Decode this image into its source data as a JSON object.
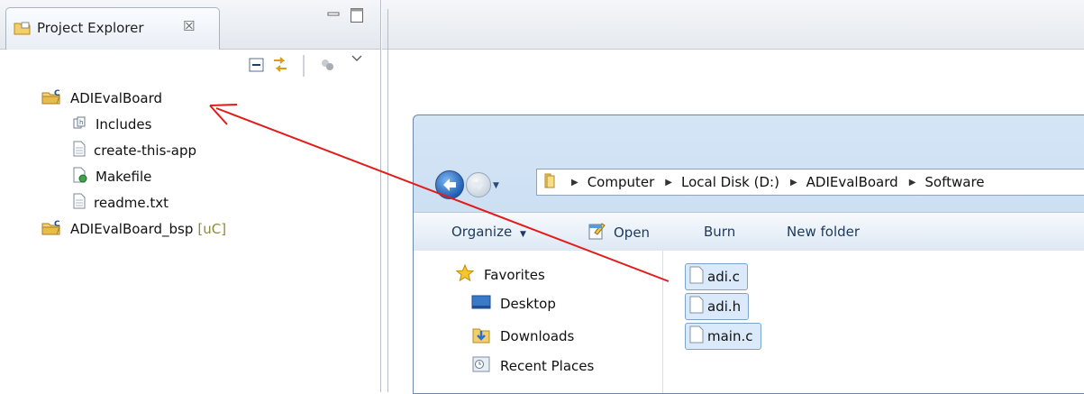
{
  "explorer": {
    "tab_title": "Project Explorer",
    "tab_close_glyph": "☒",
    "icons": [
      "project-explorer-icon",
      "collapse-all-icon",
      "link-with-editor-icon",
      "view-menu-icon"
    ],
    "tree": [
      {
        "label": "ADIEvalBoard",
        "icon": "c-project-folder-icon"
      },
      {
        "label": "Includes",
        "icon": "includes-icon"
      },
      {
        "label": "create-this-app",
        "icon": "file-icon"
      },
      {
        "label": "Makefile",
        "icon": "makefile-icon"
      },
      {
        "label": "readme.txt",
        "icon": "file-icon"
      },
      {
        "label": "ADIEvalBoard_bsp",
        "decoration": "[uC]",
        "icon": "c-project-folder-icon"
      }
    ]
  },
  "windows_explorer": {
    "breadcrumbs": [
      "Computer",
      "Local Disk (D:)",
      "ADIEvalBoard",
      "Software"
    ],
    "commands": {
      "organize": "Organize",
      "open": "Open",
      "burn": "Burn",
      "new_folder": "New folder"
    },
    "nav": [
      {
        "label": "Favorites",
        "icon": "star-icon"
      },
      {
        "label": "Desktop",
        "icon": "desktop-icon"
      },
      {
        "label": "Downloads",
        "icon": "downloads-icon"
      },
      {
        "label": "Recent Places",
        "icon": "recent-places-icon"
      }
    ],
    "files": [
      "adi.c",
      "adi.h",
      "main.c"
    ]
  },
  "colors": {
    "accent": "#e21b1b",
    "selection": "#dbeafa",
    "selection_border": "#7da2ce",
    "decoration": "#8e8a3a"
  }
}
